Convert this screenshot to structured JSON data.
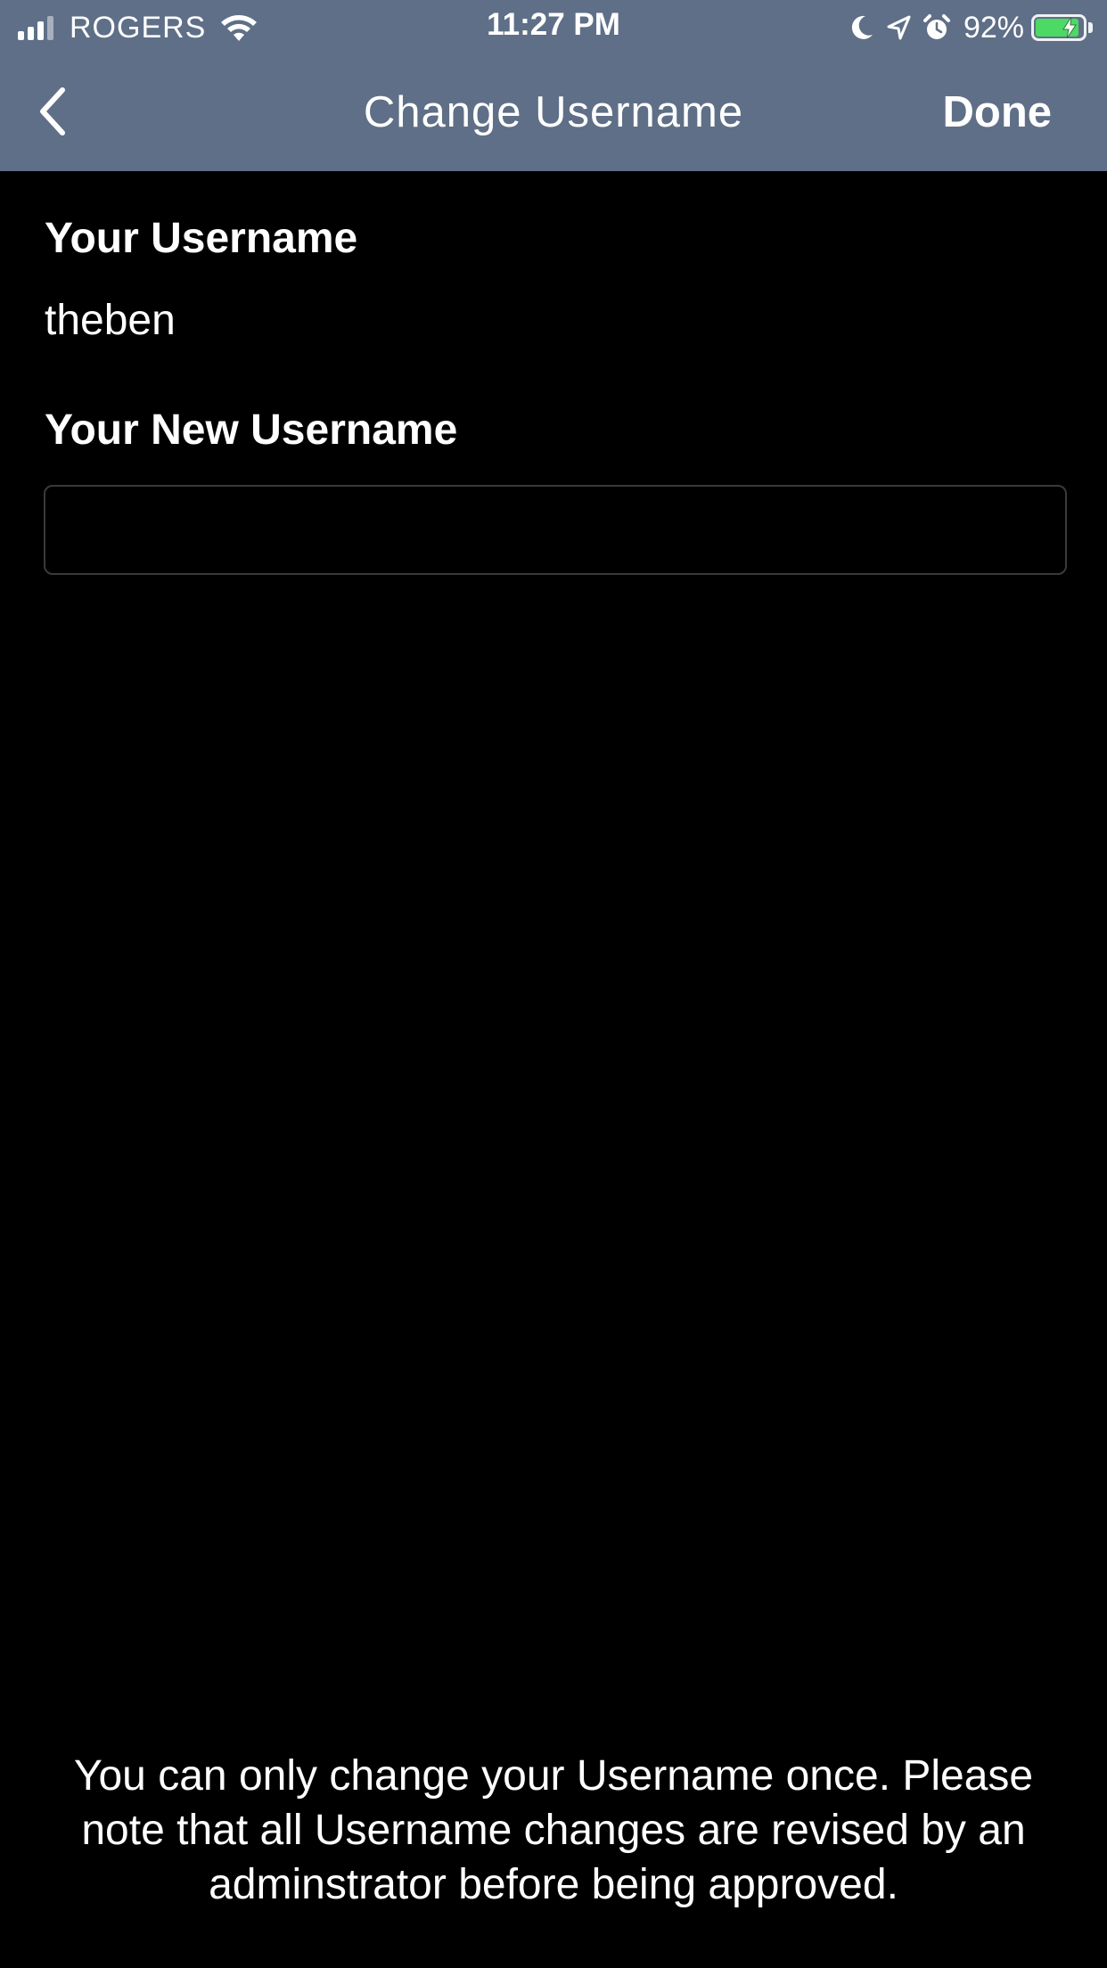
{
  "status_bar": {
    "carrier": "ROGERS",
    "time": "11:27 PM",
    "battery_percent_label": "92%",
    "battery_level": 0.92,
    "icons": [
      "signal-icon",
      "wifi-icon",
      "moon-icon",
      "location-arrow-icon",
      "alarm-icon",
      "battery-charging-icon"
    ]
  },
  "nav": {
    "back_icon": "chevron-left-icon",
    "title": "Change Username",
    "done_label": "Done"
  },
  "form": {
    "current_label": "Your Username",
    "current_value": "theben",
    "new_label": "Your New Username",
    "new_value": "",
    "new_placeholder": ""
  },
  "notice": "You can only change your Username once. Please note that all Username changes are revised by an adminstrator before being approved.",
  "colors": {
    "header_bg": "#5f6f87",
    "page_bg": "#000000",
    "text": "#ffffff",
    "input_border": "#3a3a3c",
    "battery_fill": "#4cd964"
  }
}
